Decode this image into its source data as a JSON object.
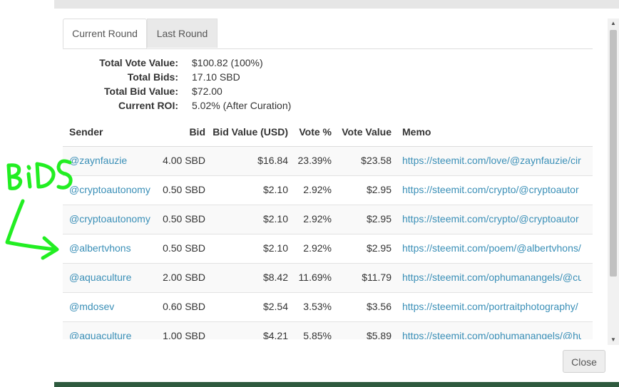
{
  "tabs": [
    {
      "label": "Current Round",
      "active": true
    },
    {
      "label": "Last Round",
      "active": false
    }
  ],
  "summary": [
    {
      "key": "Total Vote Value:",
      "value": "$100.82 (100%)"
    },
    {
      "key": "Total Bids:",
      "value": "17.10 SBD"
    },
    {
      "key": "Total Bid Value:",
      "value": "$72.00"
    },
    {
      "key": "Current ROI:",
      "value": "5.02% (After Curation)"
    }
  ],
  "table": {
    "headers": {
      "sender": "Sender",
      "bid": "Bid",
      "bid_value": "Bid Value (USD)",
      "vote_pct": "Vote %",
      "vote_value": "Vote Value",
      "memo": "Memo"
    },
    "rows": [
      {
        "sender": "@zaynfauzie",
        "bid": "4.00 SBD",
        "bid_value": "$16.84",
        "vote_pct": "23.39%",
        "vote_value": "$23.58",
        "memo": "https://steemit.com/love/@zaynfauzie/cir"
      },
      {
        "sender": "@cryptoautonomy",
        "bid": "0.50 SBD",
        "bid_value": "$2.10",
        "vote_pct": "2.92%",
        "vote_value": "$2.95",
        "memo": "https://steemit.com/crypto/@cryptoautor"
      },
      {
        "sender": "@cryptoautonomy",
        "bid": "0.50 SBD",
        "bid_value": "$2.10",
        "vote_pct": "2.92%",
        "vote_value": "$2.95",
        "memo": "https://steemit.com/crypto/@cryptoautor"
      },
      {
        "sender": "@albertvhons",
        "bid": "0.50 SBD",
        "bid_value": "$2.10",
        "vote_pct": "2.92%",
        "vote_value": "$2.95",
        "memo": "https://steemit.com/poem/@albertvhons/"
      },
      {
        "sender": "@aquaculture",
        "bid": "2.00 SBD",
        "bid_value": "$8.42",
        "vote_pct": "11.69%",
        "vote_value": "$11.79",
        "memo": "https://steemit.com/ophumanangels/@cu"
      },
      {
        "sender": "@mdosev",
        "bid": "0.60 SBD",
        "bid_value": "$2.54",
        "vote_pct": "3.53%",
        "vote_value": "$3.56",
        "memo": "https://steemit.com/portraitphotography/"
      },
      {
        "sender": "@aquaculture",
        "bid": "1.00 SBD",
        "bid_value": "$4.21",
        "vote_pct": "5.85%",
        "vote_value": "$5.89",
        "memo": "https://steemit.com/ophumanangels/@hu"
      }
    ]
  },
  "buttons": {
    "close": "Close"
  },
  "scrollbar": {
    "up_arrow": "▲",
    "down_arrow": "▼"
  },
  "annotation": {
    "text": "BiDS",
    "color": "#22ee22"
  },
  "colors": {
    "link": "#3a8fb7",
    "footer": "#2e5a3e"
  }
}
